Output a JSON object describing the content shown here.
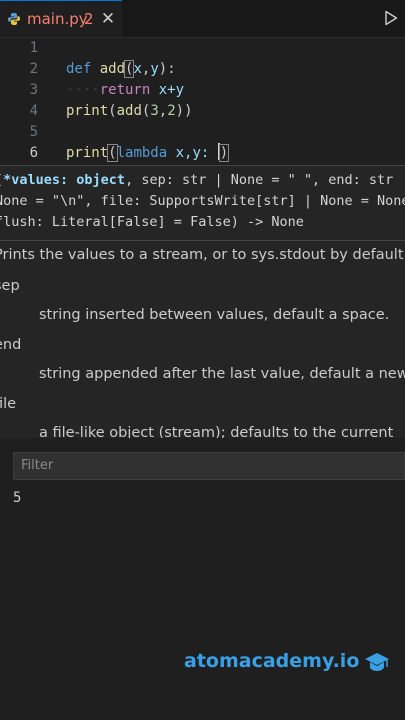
{
  "tab": {
    "filename": "main.py",
    "problem_count": "2",
    "close_glyph": "✕"
  },
  "editor": {
    "lines": [
      {
        "number": "1"
      },
      {
        "number": "2",
        "kw": "def",
        "name": "add",
        "open": "(",
        "p1": "x",
        "comma": ",",
        "p2": "y",
        "close": "):"
      },
      {
        "number": "3",
        "indent": "····",
        "kw": "return",
        "expr": " x+y"
      },
      {
        "number": "4",
        "fn": "print",
        "rest_open": "(",
        "inner_fn": "add",
        "args_open": "(",
        "a": "3",
        "comma": ",",
        "b": "2",
        "rest_close": "))"
      },
      {
        "number": "5"
      },
      {
        "number": "6",
        "fn": "print",
        "open": "(",
        "kw": "lambda",
        "vars": " x,y: ",
        "close": ")"
      }
    ]
  },
  "hover": {
    "signature_line1_prefix": "(",
    "signature_line1_param": "*values: object",
    "signature_line1_rest": ", sep: str | None = \" \", end: str",
    "signature_line2": "None = \"\\n\", file: SupportsWrite[str] | None = None,",
    "signature_line3": "flush: Literal[False] = False) -> None",
    "description": "Prints the values to a stream, or to sys.stdout by default.",
    "params": [
      {
        "name": "sep",
        "text": "string inserted between values, default a space."
      },
      {
        "name": "end",
        "text": "string appended after the last value, default a newline."
      },
      {
        "name": "file",
        "text": "a file-like object (stream); defaults to the current"
      }
    ]
  },
  "output": {
    "filter_placeholder": "Filter",
    "lines": [
      "5"
    ]
  },
  "brand": {
    "text": "atomacademy.io"
  },
  "colors": {
    "accent": "#0078d4",
    "error_tab": "#f88070",
    "brand": "#3aa0e6"
  },
  "icons": {
    "file": "python-icon",
    "run": "play-icon",
    "brand": "graduation-cap-icon"
  }
}
